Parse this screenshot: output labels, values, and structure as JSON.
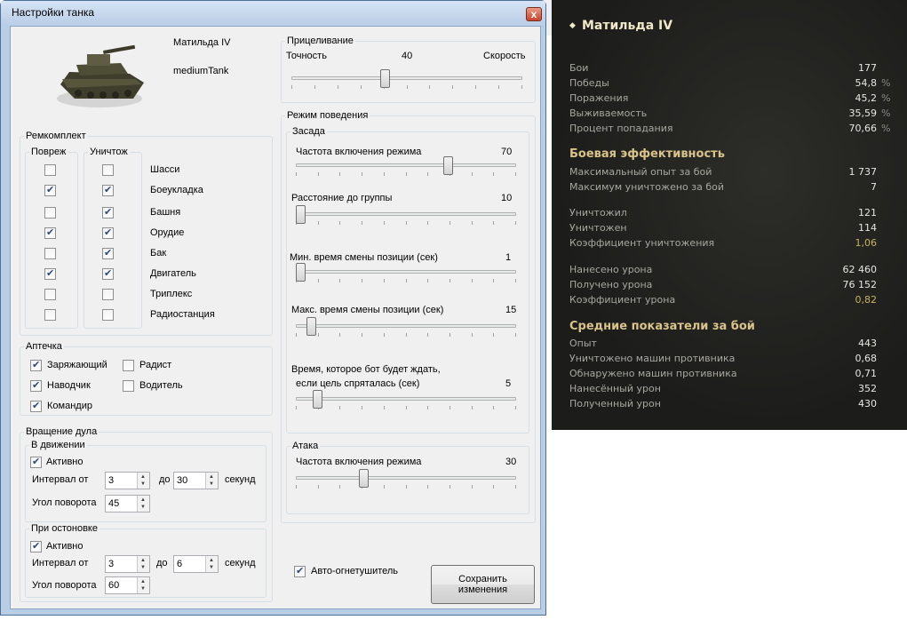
{
  "dialog": {
    "title": "Настройки танка",
    "close_label": "x",
    "tank": {
      "name": "Матильда IV",
      "class": "mediumTank"
    },
    "repair": {
      "legend": "Ремкомплект",
      "col_damaged": "Повреж",
      "col_destroyed": "Уничтож",
      "modules": [
        {
          "label": "Шасси",
          "damaged": false,
          "destroyed": false
        },
        {
          "label": "Боеукладка",
          "damaged": true,
          "destroyed": true
        },
        {
          "label": "Башня",
          "damaged": false,
          "destroyed": true
        },
        {
          "label": "Орудие",
          "damaged": true,
          "destroyed": true
        },
        {
          "label": "Бак",
          "damaged": false,
          "destroyed": true
        },
        {
          "label": "Двигатель",
          "damaged": true,
          "destroyed": true
        },
        {
          "label": "Триплекс",
          "damaged": false,
          "destroyed": false
        },
        {
          "label": "Радиостанция",
          "damaged": false,
          "destroyed": false
        }
      ]
    },
    "medkit": {
      "legend": "Аптечка",
      "crew": [
        {
          "label": "Заряжающий",
          "checked": true
        },
        {
          "label": "Радист",
          "checked": false
        },
        {
          "label": "Наводчик",
          "checked": true
        },
        {
          "label": "Водитель",
          "checked": false
        },
        {
          "label": "Командир",
          "checked": true
        }
      ]
    },
    "turret": {
      "legend": "Вращение дула",
      "moving": {
        "legend": "В движении",
        "active_label": "Активно",
        "active": true,
        "interval_label": "Интервал от",
        "from": "3",
        "to_label": "до",
        "to": "30",
        "unit": "секунд",
        "angle_label": "Угол поворота",
        "angle": "45"
      },
      "stopped": {
        "legend": "При остоновке",
        "active_label": "Активно",
        "active": true,
        "interval_label": "Интервал от",
        "from": "3",
        "to_label": "до",
        "to": "6",
        "unit": "секунд",
        "angle_label": "Угол поворота",
        "angle": "60"
      }
    },
    "aiming": {
      "legend": "Прицеливание",
      "left_label": "Точность",
      "right_label": "Скорость",
      "value": "40",
      "fraction": 0.4
    },
    "behavior": {
      "legend": "Режим поведения",
      "ambush": {
        "legend": "Засада",
        "sliders": [
          {
            "label": "Частота включения режима",
            "value": "70",
            "fraction": 0.7
          },
          {
            "label": "Расстояние до группы",
            "value": "10",
            "fraction": 0.0
          },
          {
            "label": "Мин. время смены позиции (сек)",
            "value": "1",
            "fraction": 0.0
          },
          {
            "label": "Макс. время смены позиции (сек)",
            "value": "15",
            "fraction": 0.05
          },
          {
            "label_line1": "Время, которое бот будет ждать,",
            "label_line2": "если цель спряталась (сек)",
            "value": "5",
            "fraction": 0.08
          }
        ]
      },
      "attack": {
        "legend": "Атака",
        "label": "Частота включения режима",
        "value": "30",
        "fraction": 0.3
      }
    },
    "auto_extinguisher": {
      "label": "Авто-огнетушитель",
      "checked": true
    },
    "save_line1": "Сохранить",
    "save_line2": "изменения"
  },
  "stats": {
    "title": "Матильда IV",
    "general": [
      {
        "label": "Бои",
        "value": "177",
        "pct": ""
      },
      {
        "label": "Победы",
        "value": "54,8",
        "pct": "%"
      },
      {
        "label": "Поражения",
        "value": "45,2",
        "pct": "%"
      },
      {
        "label": "Выживаемость",
        "value": "35,59",
        "pct": "%"
      },
      {
        "label": "Процент попадания",
        "value": "70,66",
        "pct": "%"
      }
    ],
    "efficiency_title": "Боевая эффективность",
    "efficiency": [
      {
        "label": "Максимальный опыт за бой",
        "value": "1 737"
      },
      {
        "label": "Максимум уничтожено за бой",
        "value": "7"
      },
      {
        "label": "Уничтожил",
        "value": "121"
      },
      {
        "label": "Уничтожен",
        "value": "114"
      },
      {
        "label": "Коэффициент уничтожения",
        "value": "1,06"
      },
      {
        "label": "Нанесено урона",
        "value": "62 460"
      },
      {
        "label": "Получено урона",
        "value": "76 152"
      },
      {
        "label": "Коэффициент урона",
        "value": "0,82"
      }
    ],
    "average_title": "Средние показатели за бой",
    "average": [
      {
        "label": "Опыт",
        "value": "443"
      },
      {
        "label": "Уничтожено машин противника",
        "value": "0,68"
      },
      {
        "label": "Обнаружено машин противника",
        "value": "0,71"
      },
      {
        "label": "Нанесённый урон",
        "value": "352"
      },
      {
        "label": "Полученный урон",
        "value": "430"
      }
    ]
  }
}
